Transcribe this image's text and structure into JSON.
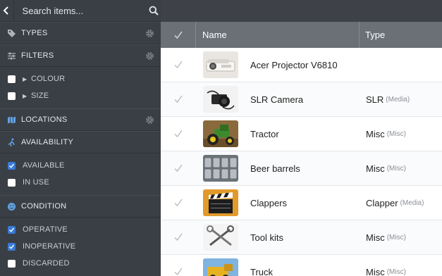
{
  "search": {
    "placeholder": "Search items..."
  },
  "sidebar": {
    "types": {
      "title": "TYPES"
    },
    "filters": {
      "title": "FILTERS",
      "options": [
        {
          "label": "COLOUR",
          "checked": false
        },
        {
          "label": "SIZE",
          "checked": false
        }
      ]
    },
    "locations": {
      "title": "LOCATIONS"
    },
    "availability": {
      "title": "AVAILABILITY",
      "options": [
        {
          "label": "AVAILABLE",
          "checked": true
        },
        {
          "label": "IN USE",
          "checked": false
        }
      ]
    },
    "condition": {
      "title": "CONDITION",
      "options": [
        {
          "label": "OPERATIVE",
          "checked": true
        },
        {
          "label": "INOPERATIVE",
          "checked": true
        },
        {
          "label": "DISCARDED",
          "checked": false
        }
      ]
    }
  },
  "table": {
    "columns": {
      "name": "Name",
      "type": "Type"
    },
    "rows": [
      {
        "name": "Acer Projector V6810",
        "type": "",
        "sub": "",
        "thumb": "projector"
      },
      {
        "name": "SLR Camera",
        "type": "SLR",
        "sub": "(Media)",
        "thumb": "camera"
      },
      {
        "name": "Tractor",
        "type": "Misc",
        "sub": "(Misc)",
        "thumb": "tractor"
      },
      {
        "name": "Beer barrels",
        "type": "Misc",
        "sub": "(Misc)",
        "thumb": "barrels"
      },
      {
        "name": "Clappers",
        "type": "Clapper",
        "sub": "(Media)",
        "thumb": "clapper"
      },
      {
        "name": "Tool kits",
        "type": "Misc",
        "sub": "(Misc)",
        "thumb": "tools"
      },
      {
        "name": "Truck",
        "type": "Misc",
        "sub": "(Misc)",
        "thumb": "truck"
      }
    ]
  },
  "colors": {
    "sidebar": "#3a3f45",
    "header": "#6b7077",
    "accent": "#3a7bd5"
  }
}
